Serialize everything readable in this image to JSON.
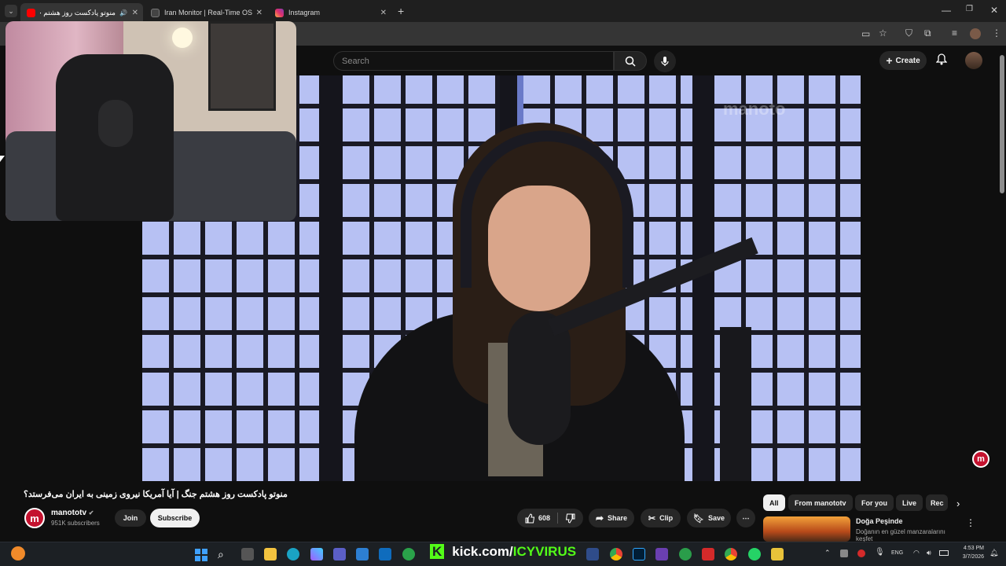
{
  "browser": {
    "tabs": [
      {
        "title": "منوتو پادکست روز هشتم جنگ",
        "active": true,
        "favicon_color": "#ff0000"
      },
      {
        "title": "Iran Monitor | Real-Time OSINT",
        "active": false,
        "favicon_color": "#333333"
      },
      {
        "title": "Instagram",
        "active": false,
        "favicon_color": "#e1306c"
      }
    ],
    "new_tab": "+"
  },
  "youtube": {
    "search_placeholder": "Search",
    "create_label": "Create",
    "video": {
      "title": "منوتو پادکست روز هشتم جنگ | آیا آمریکا نیروی زمینی به ایران می‌فرستد؟",
      "watermark": "manoto",
      "channel": {
        "name": "manototv",
        "subscribers": "951K subscribers",
        "avatar_letter": "m",
        "verified": true
      },
      "join_label": "Join",
      "subscribe_label": "Subscribe",
      "likes": "608",
      "share_label": "Share",
      "clip_label": "Clip",
      "save_label": "Save"
    },
    "chips": [
      "All",
      "From manototv",
      "For you",
      "Live",
      "Rec"
    ],
    "recommendation": {
      "title": "Doğa Peşinde",
      "description": "Doğanın en güzel manzaralarını",
      "description2": "keşfet"
    }
  },
  "overlay": {
    "kick_prefix": "kick.com/",
    "kick_user": "ICYVIRUS"
  },
  "taskbar": {
    "language": "ENG",
    "time": "4:53 PM",
    "date": "3/7/2026"
  }
}
